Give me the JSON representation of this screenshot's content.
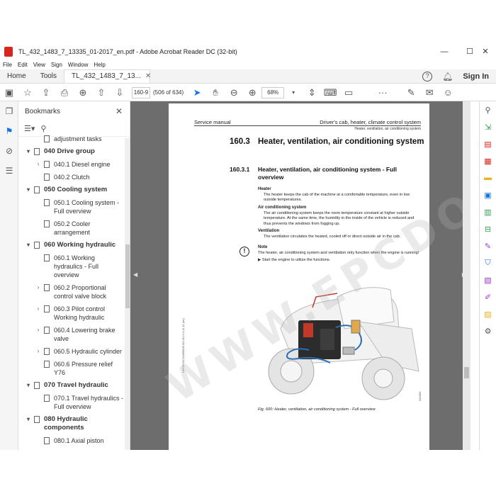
{
  "window": {
    "title": "TL_432_1483_7_13335_01-2017_en.pdf - Adobe Acrobat Reader DC (32-bit)"
  },
  "menu": [
    "File",
    "Edit",
    "View",
    "Sign",
    "Window",
    "Help"
  ],
  "tabs": {
    "home": "Home",
    "tools": "Tools",
    "doc": "TL_432_1483_7_13..."
  },
  "header_right": {
    "sign_in": "Sign In"
  },
  "toolbar": {
    "page_value": "160-9",
    "page_count": "(506 of 634)",
    "zoom": "68%"
  },
  "bookmarks": {
    "title": "Bookmarks",
    "items": [
      {
        "level": 2,
        "twisty": "",
        "label": "adjustment tasks"
      },
      {
        "level": 1,
        "twisty": "▾",
        "label": "040 Drive group"
      },
      {
        "level": 2,
        "twisty": "›",
        "label": "040.1 Diesel engine"
      },
      {
        "level": 2,
        "twisty": "",
        "label": "040.2 Clutch"
      },
      {
        "level": 1,
        "twisty": "▾",
        "label": "050 Cooling system"
      },
      {
        "level": 2,
        "twisty": "",
        "label": "050.1 Cooling system - Full overview"
      },
      {
        "level": 2,
        "twisty": "",
        "label": "050.2 Cooler arrangement"
      },
      {
        "level": 1,
        "twisty": "▾",
        "label": "060 Working hydraulic"
      },
      {
        "level": 2,
        "twisty": "",
        "label": "060.1 Working hydraulics - Full overview"
      },
      {
        "level": 2,
        "twisty": "›",
        "label": "060.2 Proportional control valve block"
      },
      {
        "level": 2,
        "twisty": "›",
        "label": "060.3 Pilot control Working hydraulic"
      },
      {
        "level": 2,
        "twisty": "›",
        "label": "060.4 Lowering brake valve"
      },
      {
        "level": 2,
        "twisty": "›",
        "label": "060.5 Hydraulic cylinder"
      },
      {
        "level": 2,
        "twisty": "",
        "label": "060.6 Pressure relief Y76"
      },
      {
        "level": 1,
        "twisty": "▾",
        "label": "070 Travel hydraulic"
      },
      {
        "level": 2,
        "twisty": "",
        "label": "070.1 Travel hydraulics - Full overview"
      },
      {
        "level": 1,
        "twisty": "▾",
        "label": "080 Hydraulic components"
      },
      {
        "level": 2,
        "twisty": "",
        "label": "080.1 Axial piston"
      }
    ]
  },
  "page": {
    "header_left": "Service manual",
    "header_right": "Driver's cab, heater, climate control system",
    "header_sub": "Heater, ventilation, air conditioning system",
    "h1_num": "160.3",
    "h1_text": "Heater, ventilation, air conditioning system",
    "h2_num": "160.3.1",
    "h2_text": "Heater, ventilation, air conditioning system - Full overview",
    "heater_title": "Heater",
    "heater_text": "The heater keeps the cab of the machine at a comfortable temperature, even in low outside temperatures.",
    "ac_title": "Air conditioning system",
    "ac_text": "The air conditioning system keeps the room temperature constant at higher outside temperature. At the same time, the humidity in the inside of the vehicle is reduced and thus prevents the windows from fogging up.",
    "vent_title": "Ventilation",
    "vent_text": "The ventilation circulates the heated, cooled off or direct outside air in the cab.",
    "note_title": "Note",
    "note_text": "The heater, air conditioning system and ventilation only function when the engine is running!",
    "note_step": "▶  Start the engine to utilize the functions.",
    "caption": "Fig. 600: Heater, ventilation, air conditioning system - Full overview",
    "side_code": "LWT/EN/1711/8060/9.0/1.0/1.9 0-11.11 (en)",
    "img_code": "430450",
    "watermark": "WWW.EPCDO.COM"
  }
}
